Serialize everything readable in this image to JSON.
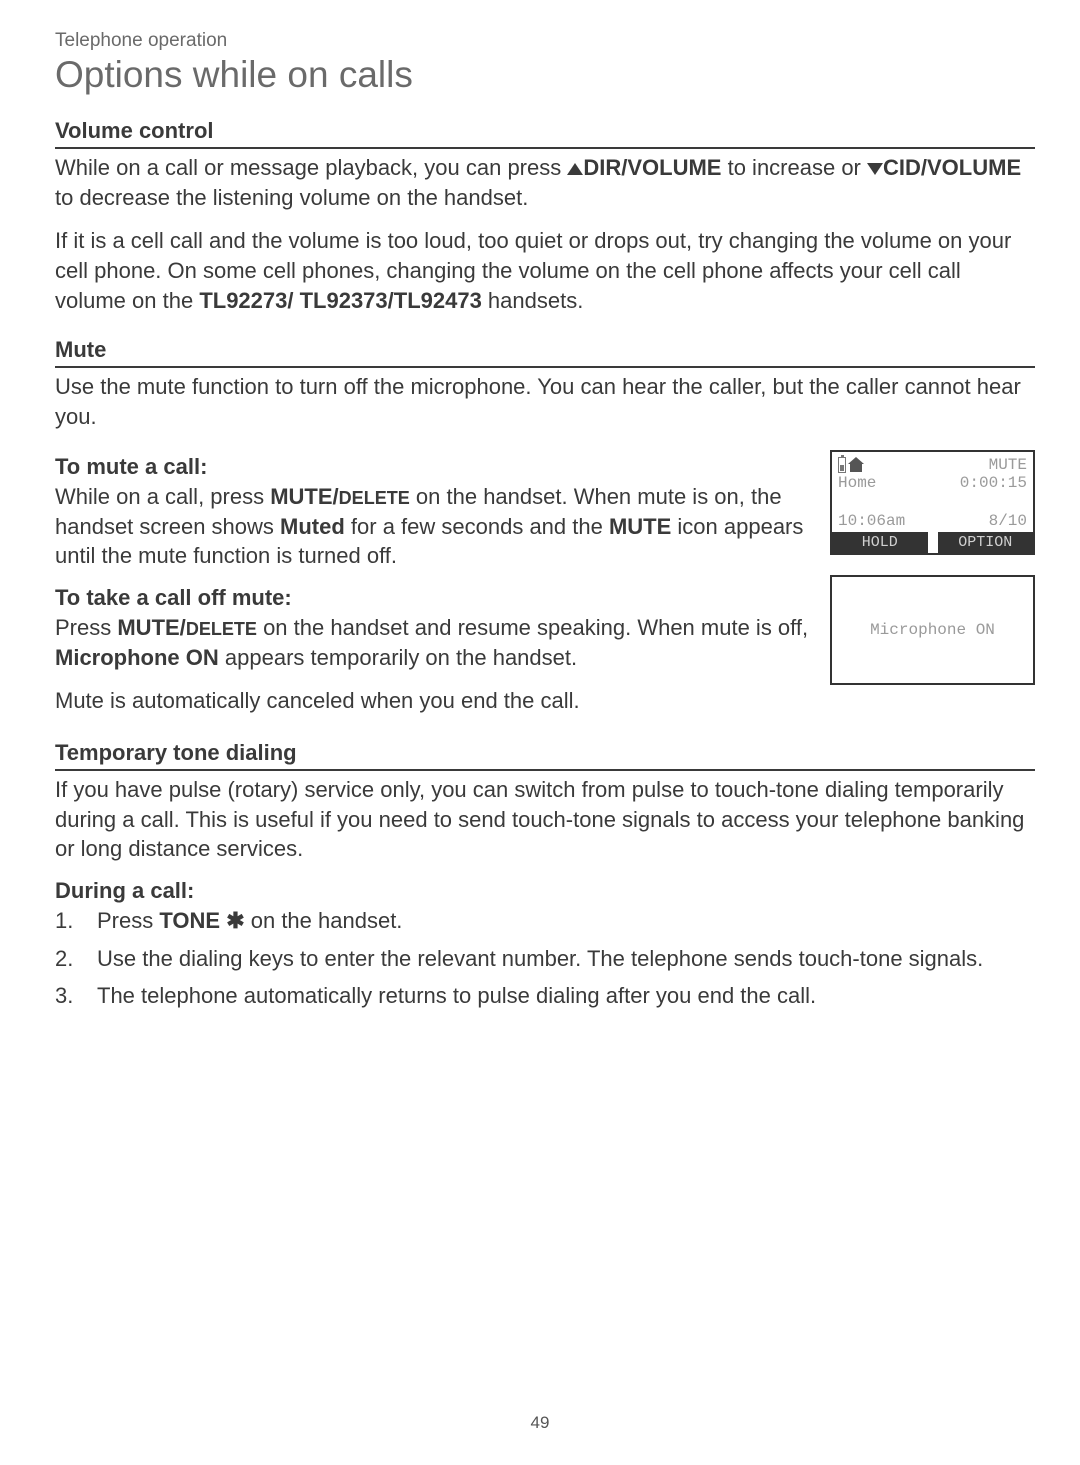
{
  "header": {
    "breadcrumb": "Telephone operation",
    "title": "Options while on calls"
  },
  "volume": {
    "heading": "Volume control",
    "para1_a": "While on a call or message playback, you can press ",
    "dir_volume": "DIR/VOLUME",
    "para1_b": " to increase or ",
    "cid_volume": "CID/VOLUME",
    "para1_c": " to decrease the listening volume on the handset.",
    "para2_a": "If it is a cell call and the volume is too loud, too quiet or drops out, try changing the volume on your cell phone. On some cell phones, changing the volume on the cell phone affects your cell call volume on the ",
    "models": "TL92273/ TL92373/TL92473",
    "para2_b": " handsets."
  },
  "mute": {
    "heading": "Mute",
    "intro": "Use the mute function to turn off the microphone. You can hear the caller, but the caller cannot hear you.",
    "to_mute_heading": "To mute a call:",
    "to_mute_a": "While on a call, press ",
    "mute_delete": "MUTE/",
    "delete_small": "DELETE",
    "to_mute_b": " on the handset. When mute is on, the handset screen shows ",
    "muted": "Muted",
    "to_mute_c": " for a few seconds and the ",
    "mute_icon": "MUTE",
    "to_mute_d": " icon appears until the mute function is turned off.",
    "off_mute_heading": "To take a call off mute:",
    "off_mute_a": "Press ",
    "off_mute_b": " on the handset and resume speaking. When mute is off, ",
    "mic_on": "Microphone ON",
    "off_mute_c": " appears temporarily on the handset.",
    "auto_cancel": "Mute is automatically canceled when you end the call."
  },
  "screen1": {
    "mute_label": "MUTE",
    "home": "Home",
    "timer": "0:00:15",
    "time": "10:06am",
    "date": "8/10",
    "hold": "HOLD",
    "option": "OPTION"
  },
  "screen2": {
    "text": "Microphone ON"
  },
  "tone": {
    "heading": "Temporary tone dialing",
    "intro": "If you have pulse (rotary) service only, you can switch from pulse to touch-tone dialing temporarily during a call. This is useful if you need to send touch-tone signals to access your telephone banking or long distance services.",
    "during_heading": "During a call:",
    "step1_a": "Press ",
    "tone_key": "TONE ",
    "star": "✱",
    "step1_b": " on the handset.",
    "step2": "Use the dialing keys to enter the relevant number. The telephone sends touch-tone signals.",
    "step3": "The telephone automatically returns to pulse dialing after you end the call."
  },
  "page_number": "49"
}
